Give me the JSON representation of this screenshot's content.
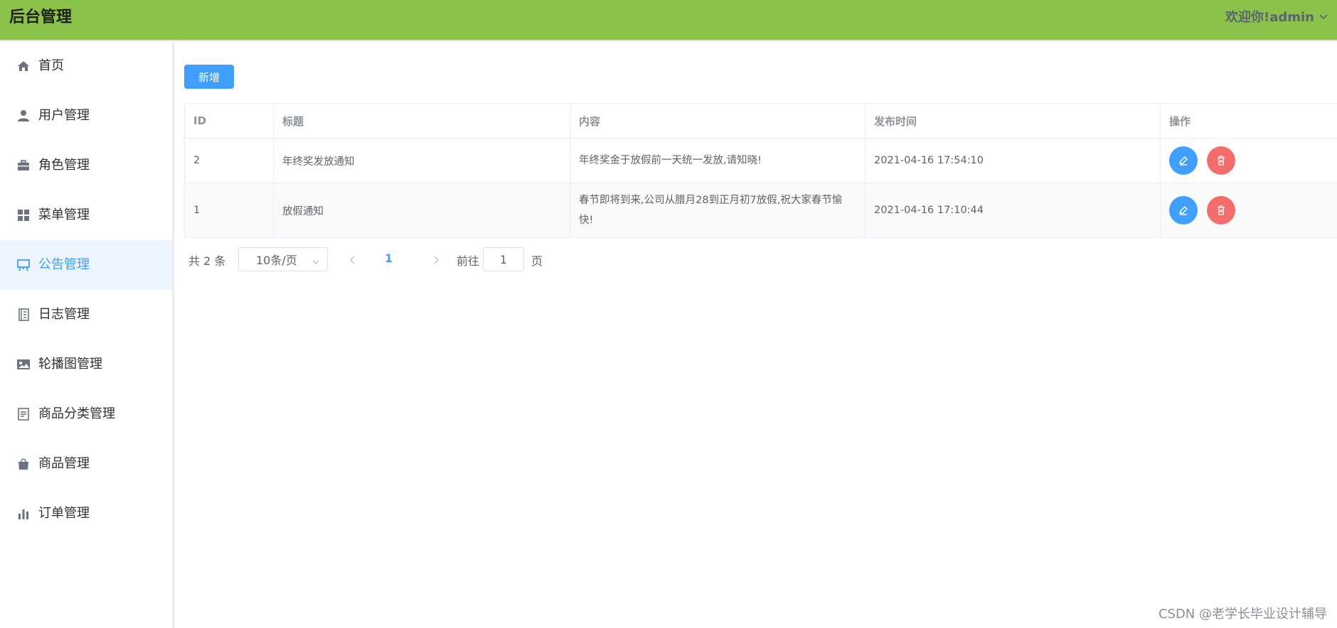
{
  "header": {
    "title": "后台管理",
    "user_greeting": "欢迎你!admin"
  },
  "sidebar": {
    "items": [
      {
        "label": "首页",
        "icon": "home-icon"
      },
      {
        "label": "用户管理",
        "icon": "user-icon"
      },
      {
        "label": "角色管理",
        "icon": "briefcase-icon"
      },
      {
        "label": "菜单管理",
        "icon": "grid-icon"
      },
      {
        "label": "公告管理",
        "icon": "easel-icon",
        "active": true
      },
      {
        "label": "日志管理",
        "icon": "notebook-icon"
      },
      {
        "label": "轮播图管理",
        "icon": "picture-icon"
      },
      {
        "label": "商品分类管理",
        "icon": "document-icon"
      },
      {
        "label": "商品管理",
        "icon": "shopping-bag-icon"
      },
      {
        "label": "订单管理",
        "icon": "bar-chart-icon"
      }
    ]
  },
  "toolbar": {
    "add_label": "新增"
  },
  "table": {
    "columns": [
      "ID",
      "标题",
      "内容",
      "发布时间",
      "操作"
    ],
    "rows": [
      {
        "id": "2",
        "title": "年终奖发放通知",
        "content": "年终奖金于放假前一天统一发放,请知晓!",
        "time": "2021-04-16 17:54:10"
      },
      {
        "id": "1",
        "title": "放假通知",
        "content": "春节即将到来,公司从腊月28到正月初7放假,祝大家春节愉快!",
        "time": "2021-04-16 17:10:44"
      }
    ]
  },
  "pagination": {
    "total_text": "共 2 条",
    "page_size": "10条/页",
    "current_page": "1",
    "goto_label": "前往",
    "goto_value": "1",
    "page_unit": "页"
  },
  "watermark": "CSDN @老学长毕业设计辅导",
  "colors": {
    "header_bg": "#8bc34a",
    "primary": "#409eff",
    "danger": "#f56c6c",
    "active_bg": "#ecf5ff"
  }
}
